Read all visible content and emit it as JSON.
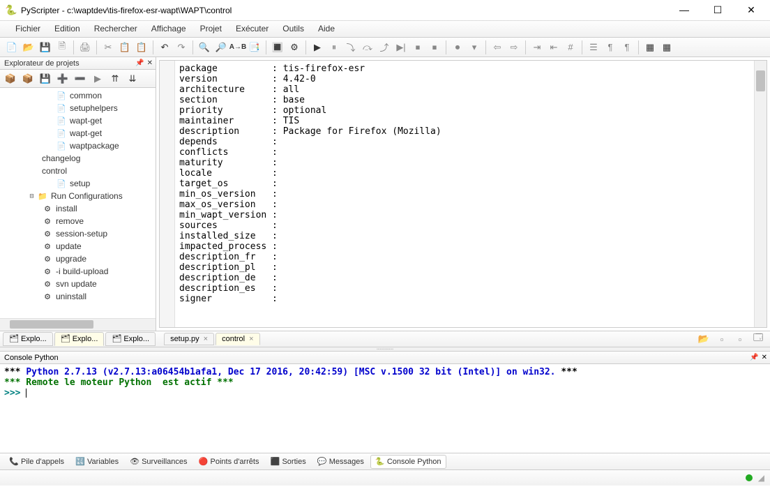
{
  "titlebar": {
    "app": "PyScripter",
    "path": "c:\\waptdev\\tis-firefox-esr-wapt\\WAPT\\control"
  },
  "menu": [
    "Fichier",
    "Edition",
    "Rechercher",
    "Affichage",
    "Projet",
    "Exécuter",
    "Outils",
    "Aide"
  ],
  "leftpane": {
    "title": "Explorateur de projets"
  },
  "tree": [
    {
      "depth": 3,
      "label": "common",
      "icon": "file"
    },
    {
      "depth": 3,
      "label": "setuphelpers",
      "icon": "file"
    },
    {
      "depth": 3,
      "label": "wapt-get",
      "icon": "file"
    },
    {
      "depth": 3,
      "label": "wapt-get",
      "icon": "file"
    },
    {
      "depth": 3,
      "label": "waptpackage",
      "icon": "file"
    },
    {
      "depth": 2,
      "label": "changelog",
      "icon": "none"
    },
    {
      "depth": 2,
      "label": "control",
      "icon": "none"
    },
    {
      "depth": 3,
      "label": "setup",
      "icon": "file"
    },
    {
      "depth": 1,
      "label": "Run Configurations",
      "icon": "folder",
      "expander": "-"
    },
    {
      "depth": 2,
      "label": "install",
      "icon": "run"
    },
    {
      "depth": 2,
      "label": "remove",
      "icon": "run"
    },
    {
      "depth": 2,
      "label": "session-setup",
      "icon": "run"
    },
    {
      "depth": 2,
      "label": "update",
      "icon": "run"
    },
    {
      "depth": 2,
      "label": "upgrade",
      "icon": "run"
    },
    {
      "depth": 2,
      "label": "-i build-upload",
      "icon": "run"
    },
    {
      "depth": 2,
      "label": "svn update",
      "icon": "run"
    },
    {
      "depth": 2,
      "label": "uninstall",
      "icon": "run"
    }
  ],
  "control_fields": [
    {
      "k": "package",
      "v": "tis-firefox-esr"
    },
    {
      "k": "version",
      "v": "4.42-0"
    },
    {
      "k": "architecture",
      "v": "all"
    },
    {
      "k": "section",
      "v": "base"
    },
    {
      "k": "priority",
      "v": "optional"
    },
    {
      "k": "maintainer",
      "v": "TIS"
    },
    {
      "k": "description",
      "v": "Package for Firefox (Mozilla)"
    },
    {
      "k": "depends",
      "v": ""
    },
    {
      "k": "conflicts",
      "v": ""
    },
    {
      "k": "maturity",
      "v": ""
    },
    {
      "k": "locale",
      "v": ""
    },
    {
      "k": "target_os",
      "v": ""
    },
    {
      "k": "min_os_version",
      "v": ""
    },
    {
      "k": "max_os_version",
      "v": ""
    },
    {
      "k": "min_wapt_version",
      "v": ""
    },
    {
      "k": "sources",
      "v": ""
    },
    {
      "k": "installed_size",
      "v": ""
    },
    {
      "k": "impacted_process",
      "v": ""
    },
    {
      "k": "description_fr",
      "v": ""
    },
    {
      "k": "description_pl",
      "v": ""
    },
    {
      "k": "description_de",
      "v": ""
    },
    {
      "k": "description_es",
      "v": ""
    },
    {
      "k": "signer",
      "v": ""
    }
  ],
  "lefttabs": [
    {
      "label": "Explo...",
      "active": false
    },
    {
      "label": "Explo...",
      "active": true
    },
    {
      "label": "Explo...",
      "active": false
    }
  ],
  "editortabs": [
    {
      "label": "setup.py",
      "active": false
    },
    {
      "label": "control",
      "active": true
    }
  ],
  "console": {
    "header": "Console Python",
    "line1_prefix": "*** ",
    "line1_mid": "Python 2.7.13 (v2.7.13:a06454b1afa1, Dec 17 2016, 20:42:59) [MSC v.1500 32 bit (Intel)] on win32.",
    "line1_suffix": " ***",
    "line2": "*** Remote le moteur Python  est actif ***",
    "prompt": ">>> "
  },
  "bottomtabs": [
    {
      "label": "Pile d'appels",
      "icon": "📞"
    },
    {
      "label": "Variables",
      "icon": "🔣"
    },
    {
      "label": "Surveillances",
      "icon": "👁"
    },
    {
      "label": "Points d'arrêts",
      "icon": "🔴"
    },
    {
      "label": "Sorties",
      "icon": "⬛"
    },
    {
      "label": "Messages",
      "icon": "💬"
    },
    {
      "label": "Console Python",
      "icon": "🐍",
      "active": true
    }
  ]
}
